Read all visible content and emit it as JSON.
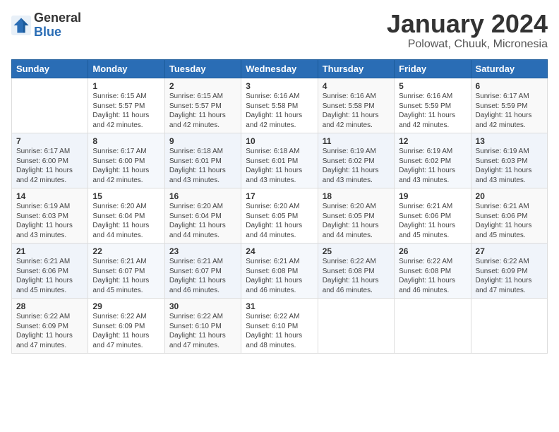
{
  "header": {
    "logo_general": "General",
    "logo_blue": "Blue",
    "month_title": "January 2024",
    "location": "Polowat, Chuuk, Micronesia"
  },
  "days_of_week": [
    "Sunday",
    "Monday",
    "Tuesday",
    "Wednesday",
    "Thursday",
    "Friday",
    "Saturday"
  ],
  "weeks": [
    [
      {
        "day": "",
        "info": ""
      },
      {
        "day": "1",
        "info": "Sunrise: 6:15 AM\nSunset: 5:57 PM\nDaylight: 11 hours\nand 42 minutes."
      },
      {
        "day": "2",
        "info": "Sunrise: 6:15 AM\nSunset: 5:57 PM\nDaylight: 11 hours\nand 42 minutes."
      },
      {
        "day": "3",
        "info": "Sunrise: 6:16 AM\nSunset: 5:58 PM\nDaylight: 11 hours\nand 42 minutes."
      },
      {
        "day": "4",
        "info": "Sunrise: 6:16 AM\nSunset: 5:58 PM\nDaylight: 11 hours\nand 42 minutes."
      },
      {
        "day": "5",
        "info": "Sunrise: 6:16 AM\nSunset: 5:59 PM\nDaylight: 11 hours\nand 42 minutes."
      },
      {
        "day": "6",
        "info": "Sunrise: 6:17 AM\nSunset: 5:59 PM\nDaylight: 11 hours\nand 42 minutes."
      }
    ],
    [
      {
        "day": "7",
        "info": "Sunrise: 6:17 AM\nSunset: 6:00 PM\nDaylight: 11 hours\nand 42 minutes."
      },
      {
        "day": "8",
        "info": "Sunrise: 6:17 AM\nSunset: 6:00 PM\nDaylight: 11 hours\nand 42 minutes."
      },
      {
        "day": "9",
        "info": "Sunrise: 6:18 AM\nSunset: 6:01 PM\nDaylight: 11 hours\nand 43 minutes."
      },
      {
        "day": "10",
        "info": "Sunrise: 6:18 AM\nSunset: 6:01 PM\nDaylight: 11 hours\nand 43 minutes."
      },
      {
        "day": "11",
        "info": "Sunrise: 6:19 AM\nSunset: 6:02 PM\nDaylight: 11 hours\nand 43 minutes."
      },
      {
        "day": "12",
        "info": "Sunrise: 6:19 AM\nSunset: 6:02 PM\nDaylight: 11 hours\nand 43 minutes."
      },
      {
        "day": "13",
        "info": "Sunrise: 6:19 AM\nSunset: 6:03 PM\nDaylight: 11 hours\nand 43 minutes."
      }
    ],
    [
      {
        "day": "14",
        "info": "Sunrise: 6:19 AM\nSunset: 6:03 PM\nDaylight: 11 hours\nand 43 minutes."
      },
      {
        "day": "15",
        "info": "Sunrise: 6:20 AM\nSunset: 6:04 PM\nDaylight: 11 hours\nand 44 minutes."
      },
      {
        "day": "16",
        "info": "Sunrise: 6:20 AM\nSunset: 6:04 PM\nDaylight: 11 hours\nand 44 minutes."
      },
      {
        "day": "17",
        "info": "Sunrise: 6:20 AM\nSunset: 6:05 PM\nDaylight: 11 hours\nand 44 minutes."
      },
      {
        "day": "18",
        "info": "Sunrise: 6:20 AM\nSunset: 6:05 PM\nDaylight: 11 hours\nand 44 minutes."
      },
      {
        "day": "19",
        "info": "Sunrise: 6:21 AM\nSunset: 6:06 PM\nDaylight: 11 hours\nand 45 minutes."
      },
      {
        "day": "20",
        "info": "Sunrise: 6:21 AM\nSunset: 6:06 PM\nDaylight: 11 hours\nand 45 minutes."
      }
    ],
    [
      {
        "day": "21",
        "info": "Sunrise: 6:21 AM\nSunset: 6:06 PM\nDaylight: 11 hours\nand 45 minutes."
      },
      {
        "day": "22",
        "info": "Sunrise: 6:21 AM\nSunset: 6:07 PM\nDaylight: 11 hours\nand 45 minutes."
      },
      {
        "day": "23",
        "info": "Sunrise: 6:21 AM\nSunset: 6:07 PM\nDaylight: 11 hours\nand 46 minutes."
      },
      {
        "day": "24",
        "info": "Sunrise: 6:21 AM\nSunset: 6:08 PM\nDaylight: 11 hours\nand 46 minutes."
      },
      {
        "day": "25",
        "info": "Sunrise: 6:22 AM\nSunset: 6:08 PM\nDaylight: 11 hours\nand 46 minutes."
      },
      {
        "day": "26",
        "info": "Sunrise: 6:22 AM\nSunset: 6:08 PM\nDaylight: 11 hours\nand 46 minutes."
      },
      {
        "day": "27",
        "info": "Sunrise: 6:22 AM\nSunset: 6:09 PM\nDaylight: 11 hours\nand 47 minutes."
      }
    ],
    [
      {
        "day": "28",
        "info": "Sunrise: 6:22 AM\nSunset: 6:09 PM\nDaylight: 11 hours\nand 47 minutes."
      },
      {
        "day": "29",
        "info": "Sunrise: 6:22 AM\nSunset: 6:09 PM\nDaylight: 11 hours\nand 47 minutes."
      },
      {
        "day": "30",
        "info": "Sunrise: 6:22 AM\nSunset: 6:10 PM\nDaylight: 11 hours\nand 47 minutes."
      },
      {
        "day": "31",
        "info": "Sunrise: 6:22 AM\nSunset: 6:10 PM\nDaylight: 11 hours\nand 48 minutes."
      },
      {
        "day": "",
        "info": ""
      },
      {
        "day": "",
        "info": ""
      },
      {
        "day": "",
        "info": ""
      }
    ]
  ]
}
